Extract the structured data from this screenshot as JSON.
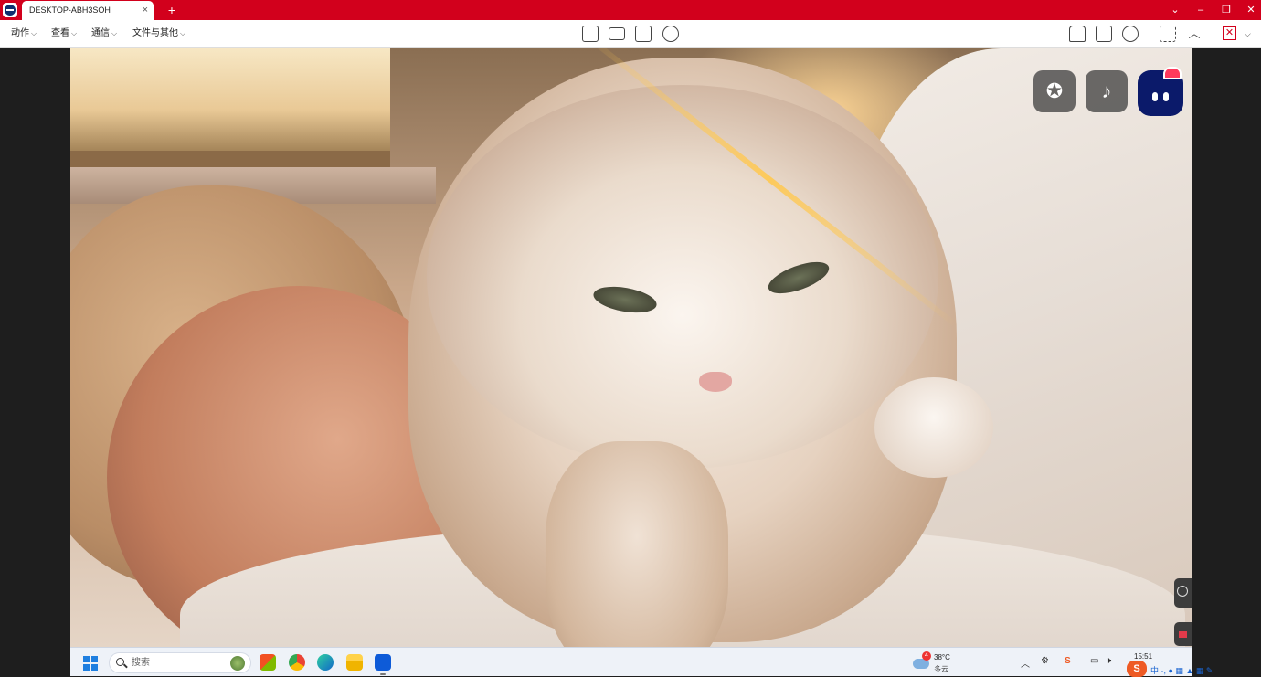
{
  "titlebar": {
    "tab_title": "DESKTOP-ABH3SOH",
    "tab_close": "×",
    "new_tab": "+",
    "window_controls": [
      "⌄",
      "–",
      "❐",
      "✕"
    ]
  },
  "menubar": {
    "menus": [
      {
        "label": "动作",
        "caret": "⌵"
      },
      {
        "label": "查看",
        "caret": "⌵"
      },
      {
        "label": "通信",
        "caret": "⌵"
      },
      {
        "label": "文件与其他",
        "caret": "⌵"
      }
    ],
    "center_tools": [
      "dashboard-icon",
      "keyboard-icon",
      "file-transfer-icon",
      "record-icon"
    ],
    "right_tools": [
      "user-icon",
      "screenshot-icon",
      "camera-icon",
      "fullscreen-icon",
      "collapse-icon",
      "end-session-icon"
    ],
    "collapse_glyph": "︿",
    "end_glyph": "✕",
    "more_caret": "⌵"
  },
  "remote": {
    "overlay_icons": [
      "star-icon",
      "tiktok-icon",
      "robot-assistant-icon"
    ],
    "overlay_glyphs": {
      "star": "✪",
      "tiktok": "♪"
    },
    "side_tabs": [
      "teamviewer-panel-icon",
      "flag-icon"
    ]
  },
  "taskbar": {
    "search_placeholder": "搜索",
    "apps": [
      "start-icon",
      "store-icon",
      "chrome-icon",
      "edge-icon",
      "file-explorer-icon",
      "teamviewer-icon"
    ],
    "weather": {
      "badge": "4",
      "temperature": "38°C",
      "condition": "多云"
    },
    "tray_icons": [
      "chevron-up-icon",
      "network-icon",
      "sogou-icon",
      "display-icon",
      "mute-icon"
    ],
    "tray_glyphs": {
      "chevron": "︿",
      "network": "⚙",
      "sogou": "S",
      "display": "▭",
      "mute": "🕨"
    },
    "clock": "15:51",
    "ime_logo": "S",
    "ime_strip": "中 ·, ● ▦ ▲ ▦ ✎"
  },
  "colors": {
    "accent": "#d2001c",
    "taskbar": "#eef2f8",
    "background": "#1e1e1e"
  }
}
